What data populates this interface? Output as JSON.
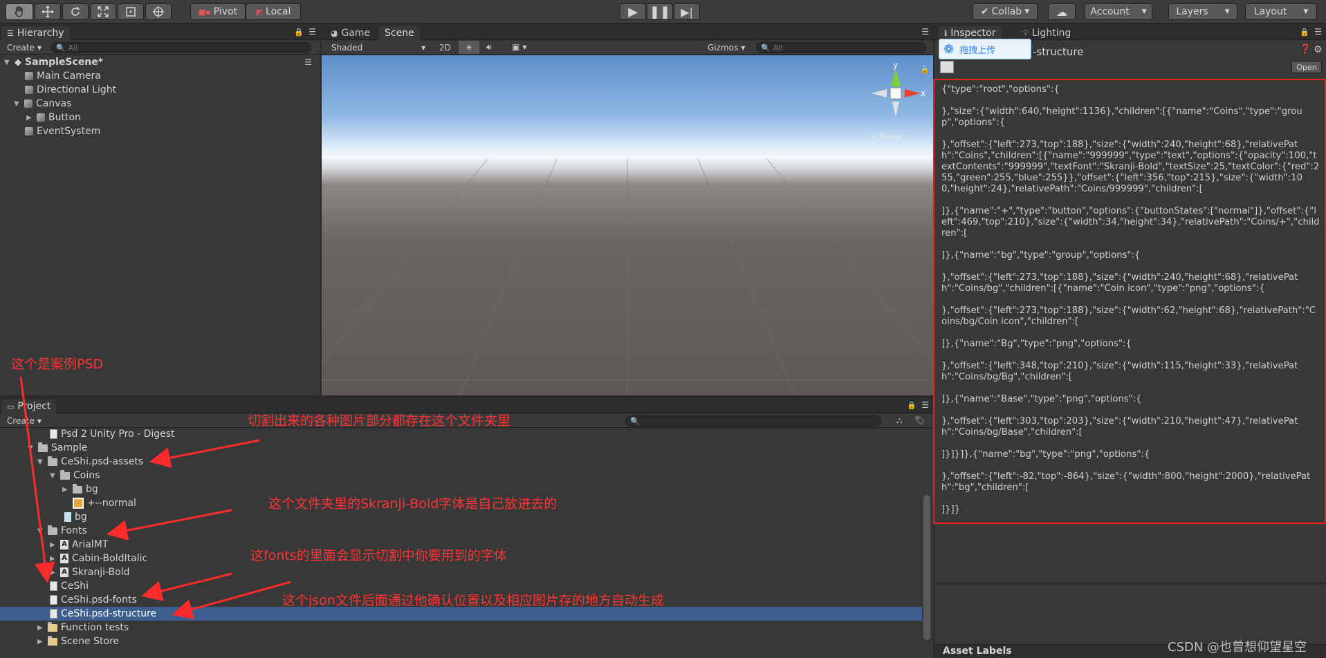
{
  "toolbar": {
    "pivot_label": "Pivot",
    "local_label": "Local",
    "collab_label": "Collab",
    "account_label": "Account",
    "layers_label": "Layers",
    "layout_label": "Layout"
  },
  "hierarchy": {
    "tab_label": "Hierarchy",
    "create_label": "Create",
    "search_placeholder": "All",
    "scene_name": "SampleScene*",
    "items": [
      {
        "label": "Main Camera"
      },
      {
        "label": "Directional Light"
      },
      {
        "label": "Canvas"
      },
      {
        "label": "Button"
      },
      {
        "label": "EventSystem"
      }
    ]
  },
  "scene_view": {
    "tab_game": "Game",
    "tab_scene": "Scene",
    "shading_mode": "Shaded",
    "mode_2d": "2D",
    "gizmos_label": "Gizmos",
    "search_placeholder": "All",
    "axis_y": "y",
    "axis_x": "x",
    "persp_label": "< Persp"
  },
  "inspector": {
    "tab_inspector": "Inspector",
    "tab_lighting": "Lighting",
    "upload_label": "拖拽上传",
    "asset_title": "-structure",
    "open_label": "Open",
    "asset_labels": "Asset Labels",
    "json_content": "{\"type\":\"root\",\"options\":{\n\n},\"size\":{\"width\":640,\"height\":1136},\"children\":[{\"name\":\"Coins\",\"type\":\"group\",\"options\":{\n\n},\"offset\":{\"left\":273,\"top\":188},\"size\":{\"width\":240,\"height\":68},\"relativePath\":\"Coins\",\"children\":[{\"name\":\"999999\",\"type\":\"text\",\"options\":{\"opacity\":100,\"textContents\":\"999999\",\"textFont\":\"Skranji-Bold\",\"textSize\":25,\"textColor\":{\"red\":255,\"green\":255,\"blue\":255}},\"offset\":{\"left\":356,\"top\":215},\"size\":{\"width\":100,\"height\":24},\"relativePath\":\"Coins/999999\",\"children\":[\n\n]},{\"name\":\"+\",\"type\":\"button\",\"options\":{\"buttonStates\":[\"normal\"]},\"offset\":{\"left\":469,\"top\":210},\"size\":{\"width\":34,\"height\":34},\"relativePath\":\"Coins/+\",\"children\":[\n\n]},{\"name\":\"bg\",\"type\":\"group\",\"options\":{\n\n},\"offset\":{\"left\":273,\"top\":188},\"size\":{\"width\":240,\"height\":68},\"relativePath\":\"Coins/bg\",\"children\":[{\"name\":\"Coin icon\",\"type\":\"png\",\"options\":{\n\n},\"offset\":{\"left\":273,\"top\":188},\"size\":{\"width\":62,\"height\":68},\"relativePath\":\"Coins/bg/Coin icon\",\"children\":[\n\n]},{\"name\":\"Bg\",\"type\":\"png\",\"options\":{\n\n},\"offset\":{\"left\":348,\"top\":210},\"size\":{\"width\":115,\"height\":33},\"relativePath\":\"Coins/bg/Bg\",\"children\":[\n\n]},{\"name\":\"Base\",\"type\":\"png\",\"options\":{\n\n},\"offset\":{\"left\":303,\"top\":203},\"size\":{\"width\":210,\"height\":47},\"relativePath\":\"Coins/bg/Base\",\"children\":[\n\n]}]}]},{\"name\":\"bg\",\"type\":\"png\",\"options\":{\n\n},\"offset\":{\"left\":-82,\"top\":-864},\"size\":{\"width\":800,\"height\":2000},\"relativePath\":\"bg\",\"children\":[\n\n]}]}"
  },
  "project": {
    "tab_label": "Project",
    "create_label": "Create",
    "items": [
      {
        "label": "Psd 2 Unity Pro - Digest"
      },
      {
        "label": "Sample"
      },
      {
        "label": "CeShi.psd-assets"
      },
      {
        "label": "Coins"
      },
      {
        "label": "bg"
      },
      {
        "label": "+--normal"
      },
      {
        "label": "bg"
      },
      {
        "label": "Fonts"
      },
      {
        "label": "ArialMT"
      },
      {
        "label": "Cabin-BoldItalic"
      },
      {
        "label": "Skranji-Bold"
      },
      {
        "label": "CeShi"
      },
      {
        "label": "CeShi.psd-fonts"
      },
      {
        "label": "CeShi.psd-structure"
      },
      {
        "label": "Function tests"
      },
      {
        "label": "Scene Store"
      }
    ]
  },
  "annotations": {
    "a1": "这个是案例PSD",
    "a2": "切割出来的各种图片部分都存在这个文件夹里",
    "a3": "这个文件夹里的Skranji-Bold字体是自己放进去的",
    "a4": "这fonts的里面会显示切割中你要用到的字体",
    "a5": "这个json文件后面通过他确认位置以及相应图片存的地方自动生成"
  },
  "watermark": "CSDN @也曾想仰望星空"
}
